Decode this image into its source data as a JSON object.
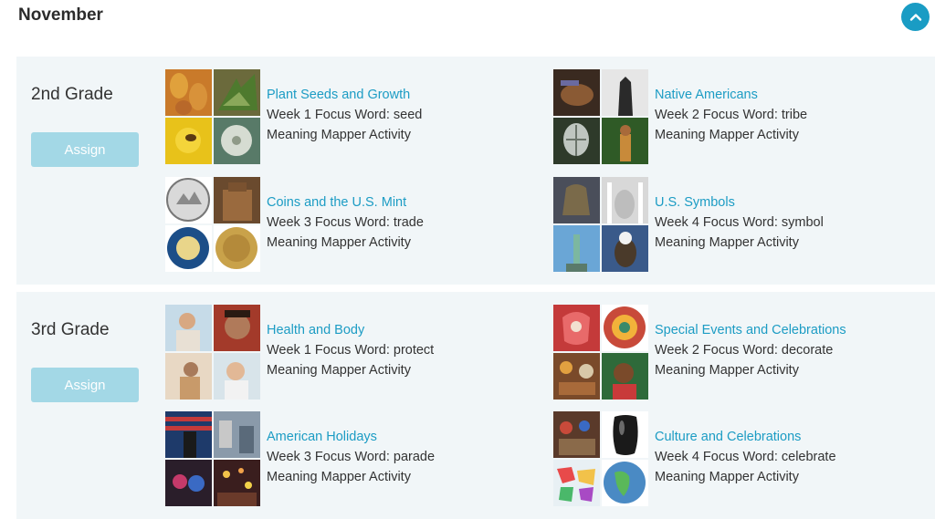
{
  "month": "November",
  "collapse_icon": "chevron-up-icon",
  "colors": {
    "accent": "#1a9cc4",
    "link": "#1c9cc4",
    "assign_button": "#a3d8e6",
    "section_bg": "#f1f6f8"
  },
  "grades": [
    {
      "title": "2nd Grade",
      "assign_label": "Assign",
      "units": [
        {
          "title": "Plant Seeds and Growth",
          "focus": "Week 1 Focus Word: seed",
          "activity": "Meaning Mapper Activity"
        },
        {
          "title": "Native Americans",
          "focus": "Week 2 Focus Word: tribe",
          "activity": "Meaning Mapper Activity"
        },
        {
          "title": "Coins and the U.S. Mint",
          "focus": "Week 3 Focus Word: trade",
          "activity": "Meaning Mapper Activity"
        },
        {
          "title": "U.S. Symbols",
          "focus": "Week 4 Focus Word: symbol",
          "activity": "Meaning Mapper Activity"
        }
      ]
    },
    {
      "title": "3rd Grade",
      "assign_label": "Assign",
      "units": [
        {
          "title": "Health and Body",
          "focus": "Week 1 Focus Word: protect",
          "activity": "Meaning Mapper Activity"
        },
        {
          "title": "Special Events and Celebrations",
          "focus": "Week 2 Focus Word: decorate",
          "activity": "Meaning Mapper Activity"
        },
        {
          "title": "American Holidays",
          "focus": "Week 3 Focus Word: parade",
          "activity": "Meaning Mapper Activity"
        },
        {
          "title": "Culture and Celebrations",
          "focus": "Week 4 Focus Word: celebrate",
          "activity": "Meaning Mapper Activity"
        }
      ]
    }
  ]
}
